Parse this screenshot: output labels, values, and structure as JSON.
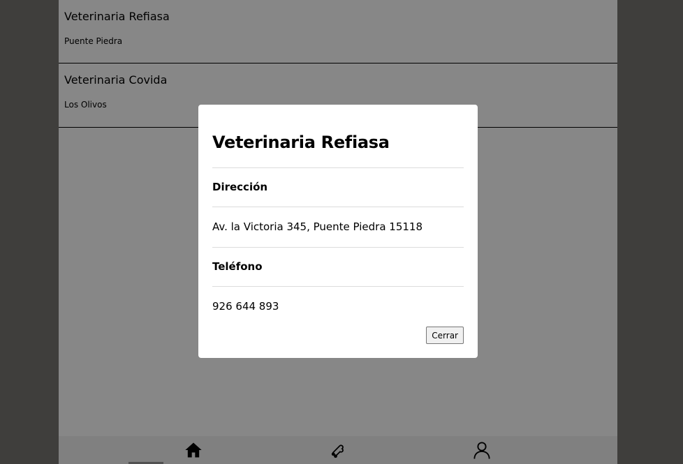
{
  "vets": [
    {
      "name": "Veterinaria Refiasa",
      "district": "Puente Piedra"
    },
    {
      "name": "Veterinaria Covida",
      "district": "Los Olivos"
    }
  ],
  "modal": {
    "title": "Veterinaria Refiasa",
    "address_label": "Dirección",
    "address_value": "Av. la Victoria 345, Puente Piedra 15118",
    "phone_label": "Teléfono",
    "phone_value": "926 644 893",
    "close_label": "Cerrar"
  },
  "nav": {
    "items": [
      "home-icon",
      "pet-icon",
      "user-icon"
    ]
  },
  "colors": {
    "overlay": "#777672",
    "modal_bg": "#ffffff",
    "nav_bg": "#f2f2f2"
  }
}
